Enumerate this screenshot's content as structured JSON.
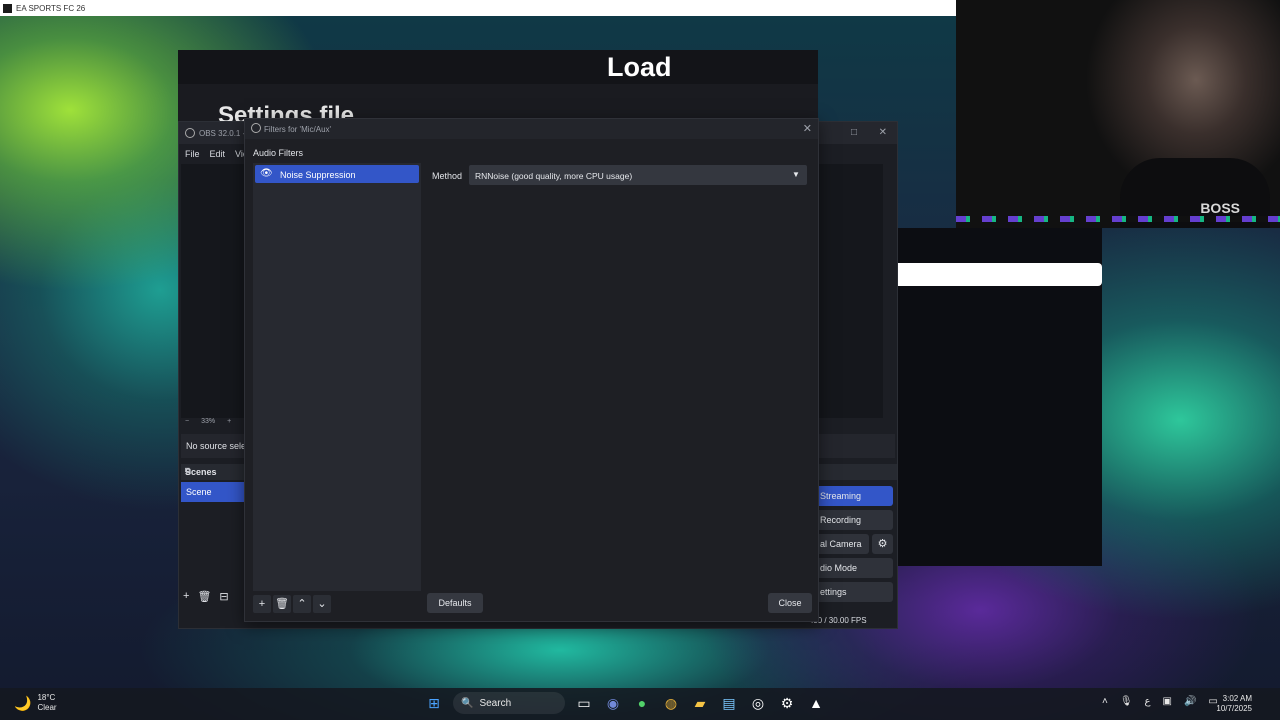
{
  "game_bar": {
    "title": "EA SPORTS FC 26"
  },
  "tutorial": {
    "load": "Load",
    "settings": "Settings file"
  },
  "webcam": {
    "shirt_text": "BOSS"
  },
  "obs": {
    "title": "OBS 32.0.1 -",
    "menu": [
      "File",
      "Edit",
      "Vie"
    ],
    "zoom": [
      "−",
      "33%",
      "+"
    ],
    "no_source": "No source sele",
    "scenes_header": "Scenes",
    "scene": "Scene",
    "scene_tools": [
      "+",
      "🗑",
      "⊟"
    ],
    "controls": {
      "streaming": "Streaming",
      "recording": "Recording",
      "virtual_camera": "al Camera",
      "studio_mode": "dio Mode",
      "settings": "ettings"
    },
    "fps": ".00 / 30.00 FPS"
  },
  "filters_dialog": {
    "title": "Filters for 'Mic/Aux'",
    "section": "Audio Filters",
    "filters": [
      {
        "name": "Noise Suppression",
        "enabled": true
      }
    ],
    "method_label": "Method",
    "method_value": "RNNoise (good quality, more CPU usage)",
    "defaults": "Defaults",
    "close": "Close"
  },
  "taskbar": {
    "weather_temp": "18°C",
    "weather_cond": "Clear",
    "search_label": "Search",
    "time": "3:02 AM",
    "date": "10/7/2025"
  },
  "colors": {
    "accent": "#3356c8",
    "panel": "#1e1f24"
  }
}
